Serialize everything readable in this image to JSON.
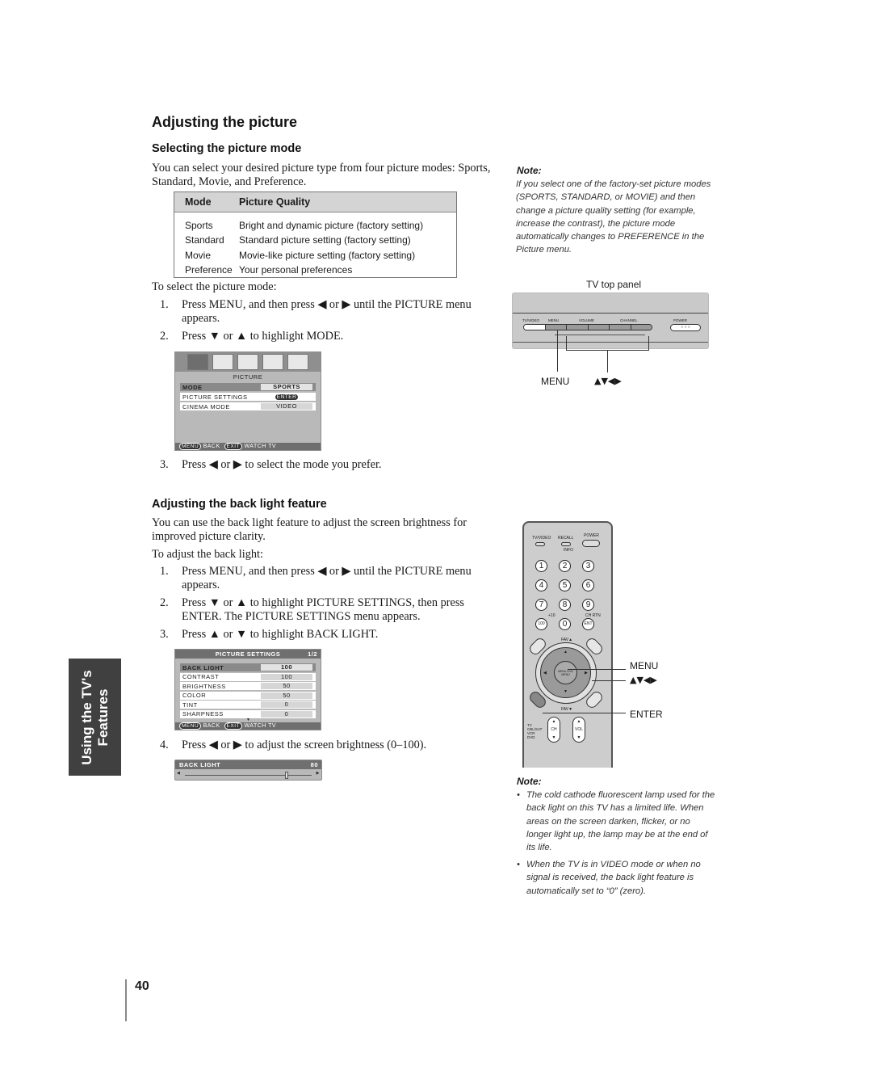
{
  "page": {
    "title": "Adjusting the picture",
    "page_number": "40",
    "side_tab": {
      "line1": "Using the TV's",
      "line2": "Features"
    }
  },
  "section_mode": {
    "heading": "Selecting the picture mode",
    "intro": "You can select your desired picture type from four picture modes: Sports, Standard, Movie, and Preference.",
    "table": {
      "headers": [
        "Mode",
        "Picture Quality"
      ],
      "rows": [
        [
          "Sports",
          "Bright and dynamic picture (factory setting)"
        ],
        [
          "Standard",
          "Standard picture setting (factory setting)"
        ],
        [
          "Movie",
          "Movie-like picture setting (factory setting)"
        ],
        [
          "Preference",
          "Your personal preferences"
        ]
      ]
    },
    "lead": "To select the picture mode:",
    "steps": [
      {
        "num": "1.",
        "text": "Press MENU, and then press ◀ or ▶ until the PICTURE menu appears."
      },
      {
        "num": "2.",
        "text": "Press ▼ or ▲ to highlight MODE."
      },
      {
        "num": "3.",
        "text": "Press ◀ or ▶  to select the mode you prefer."
      }
    ],
    "osd": {
      "title": "PICTURE",
      "items": [
        {
          "label": "MODE",
          "value": "SPORTS",
          "highlighted": true
        },
        {
          "label": "PICTURE SETTINGS",
          "value": "ENTER",
          "highlighted": false
        },
        {
          "label": "CINEMA MODE",
          "value": "VIDEO",
          "highlighted": false
        }
      ],
      "footer": {
        "menu_key": "MENU",
        "menu_label": "BACK",
        "exit_key": "EXIT",
        "exit_label": "WATCH TV"
      },
      "icons": [
        "picture-icon",
        "audio-icon",
        "setup-icon",
        "timer-icon",
        "tools-icon"
      ]
    }
  },
  "note_top": {
    "heading": "Note:",
    "text": "If you select one of the factory-set picture modes (SPORTS, STANDARD, or MOVIE) and then change a picture quality setting (for example, increase the contrast), the picture mode automatically changes to PREFERENCE in the Picture menu."
  },
  "tv_panel": {
    "caption": "TV top panel",
    "buttons": [
      "TV/VIDEO",
      "MENU",
      "VOLUME",
      "CHANNEL",
      "POWER"
    ],
    "sub_arrows": [
      "◀",
      "▶",
      "▼",
      "▲"
    ],
    "callout_menu": "MENU",
    "callout_arrows": "▲▼◀▶"
  },
  "section_backlight": {
    "heading": "Adjusting the back light feature",
    "intro": "You can use the back light feature to adjust the screen brightness for improved picture clarity.",
    "lead": "To adjust the back light:",
    "steps": [
      {
        "num": "1.",
        "text": "Press MENU, and then press ◀ or ▶ until the PICTURE menu appears."
      },
      {
        "num": "2.",
        "text": "Press ▼ or ▲ to highlight PICTURE SETTINGS, then press ENTER. The PICTURE SETTINGS menu appears."
      },
      {
        "num": "3.",
        "text": "Press ▲ or ▼ to highlight BACK LIGHT."
      },
      {
        "num": "4.",
        "text": "Press ◀ or ▶ to adjust the screen brightness (0–100)."
      }
    ],
    "osd": {
      "title": "PICTURE SETTINGS",
      "page": "1/2",
      "items": [
        {
          "label": "BACK LIGHT",
          "value": "100",
          "highlighted": true
        },
        {
          "label": "CONTRAST",
          "value": "100",
          "highlighted": false
        },
        {
          "label": "BRIGHTNESS",
          "value": "50",
          "highlighted": false
        },
        {
          "label": "COLOR",
          "value": "50",
          "highlighted": false
        },
        {
          "label": "TINT",
          "value": "0",
          "highlighted": false
        },
        {
          "label": "SHARPNESS",
          "value": "0",
          "highlighted": false
        }
      ],
      "footer": {
        "menu_key": "MENU",
        "menu_label": "BACK",
        "exit_key": "EXIT",
        "exit_label": "WATCH TV"
      }
    },
    "slider": {
      "label": "BACK LIGHT",
      "value": "80",
      "min": 0,
      "max": 100,
      "fraction": 0.8
    }
  },
  "remote": {
    "top_buttons": [
      "TV/VIDEO",
      "RECALL",
      "POWER"
    ],
    "info_label": "INFO",
    "keys": [
      "1",
      "2",
      "3",
      "4",
      "5",
      "6",
      "7",
      "8",
      "9",
      "100",
      "0",
      "ENT"
    ],
    "plus10": "+10",
    "chrtn": "CH RTN",
    "fav_up": "FAV▲",
    "fav_down": "FAV▼",
    "center": "MENU DVD MENU",
    "mode_labels": [
      "TV",
      "CBL/SAT",
      "VCR",
      "DVD"
    ],
    "ch": "CH",
    "vol": "VOL",
    "callouts": [
      "MENU",
      "▲▼◀▶",
      "ENTER"
    ]
  },
  "note_bottom": {
    "heading": "Note:",
    "bullets": [
      "The cold cathode fluorescent lamp used for the back light on this TV has a limited life. When areas on the screen darken, flicker, or no longer light up, the lamp may be at the end of its life.",
      "When the TV is in VIDEO mode or when no signal is received, the back light feature is automatically set to “0” (zero)."
    ]
  }
}
